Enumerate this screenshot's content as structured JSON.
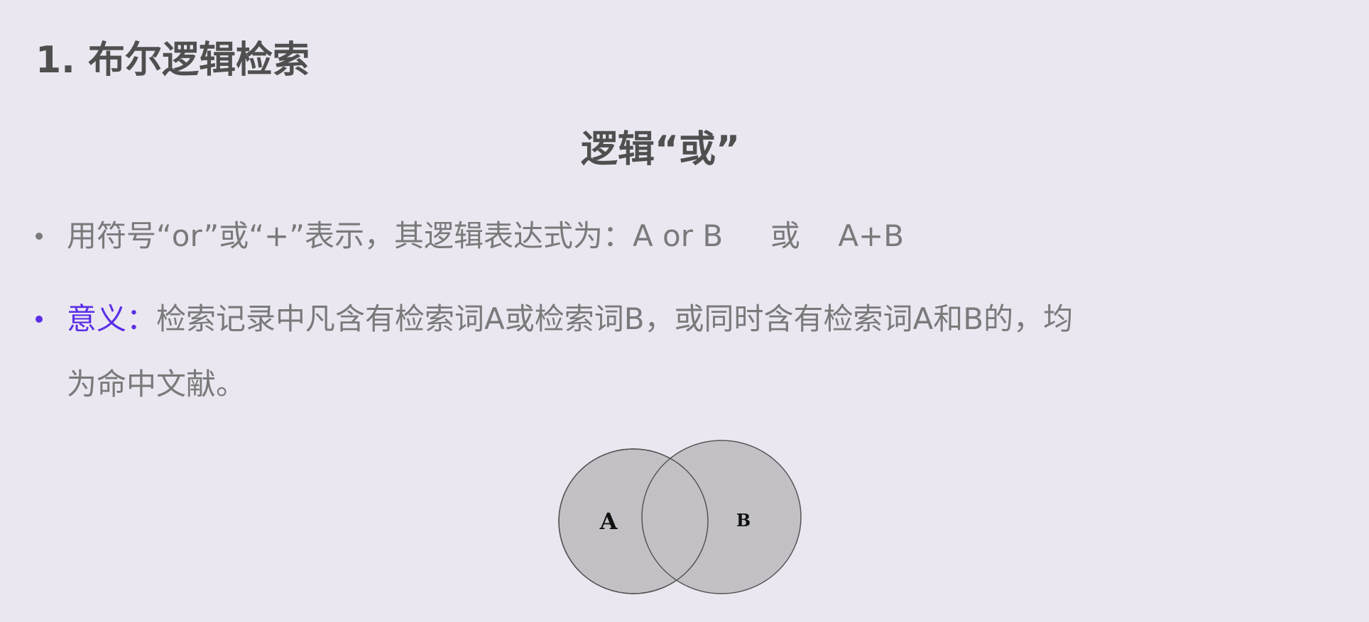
{
  "heading": "1. 布尔逻辑检索",
  "subheading": "逻辑“或”",
  "bullets": [
    {
      "text": "用符号“or”或“+”表示，其逻辑表达式为：A or B     或    A+B"
    },
    {
      "label": "意义：",
      "text": "检索记录中凡含有检索词A或检索词B，或同时含有检索词A和B的，均",
      "text_cont": "为命中文献。"
    }
  ],
  "venn": {
    "set_a": "A",
    "set_b": "B",
    "fill": "#c4c2c6",
    "stroke": "#555555"
  },
  "colors": {
    "accent": "#5a2ee6",
    "text": "#7a7a7a",
    "heading": "#4f4f4f",
    "background": "#ebe7f1"
  }
}
